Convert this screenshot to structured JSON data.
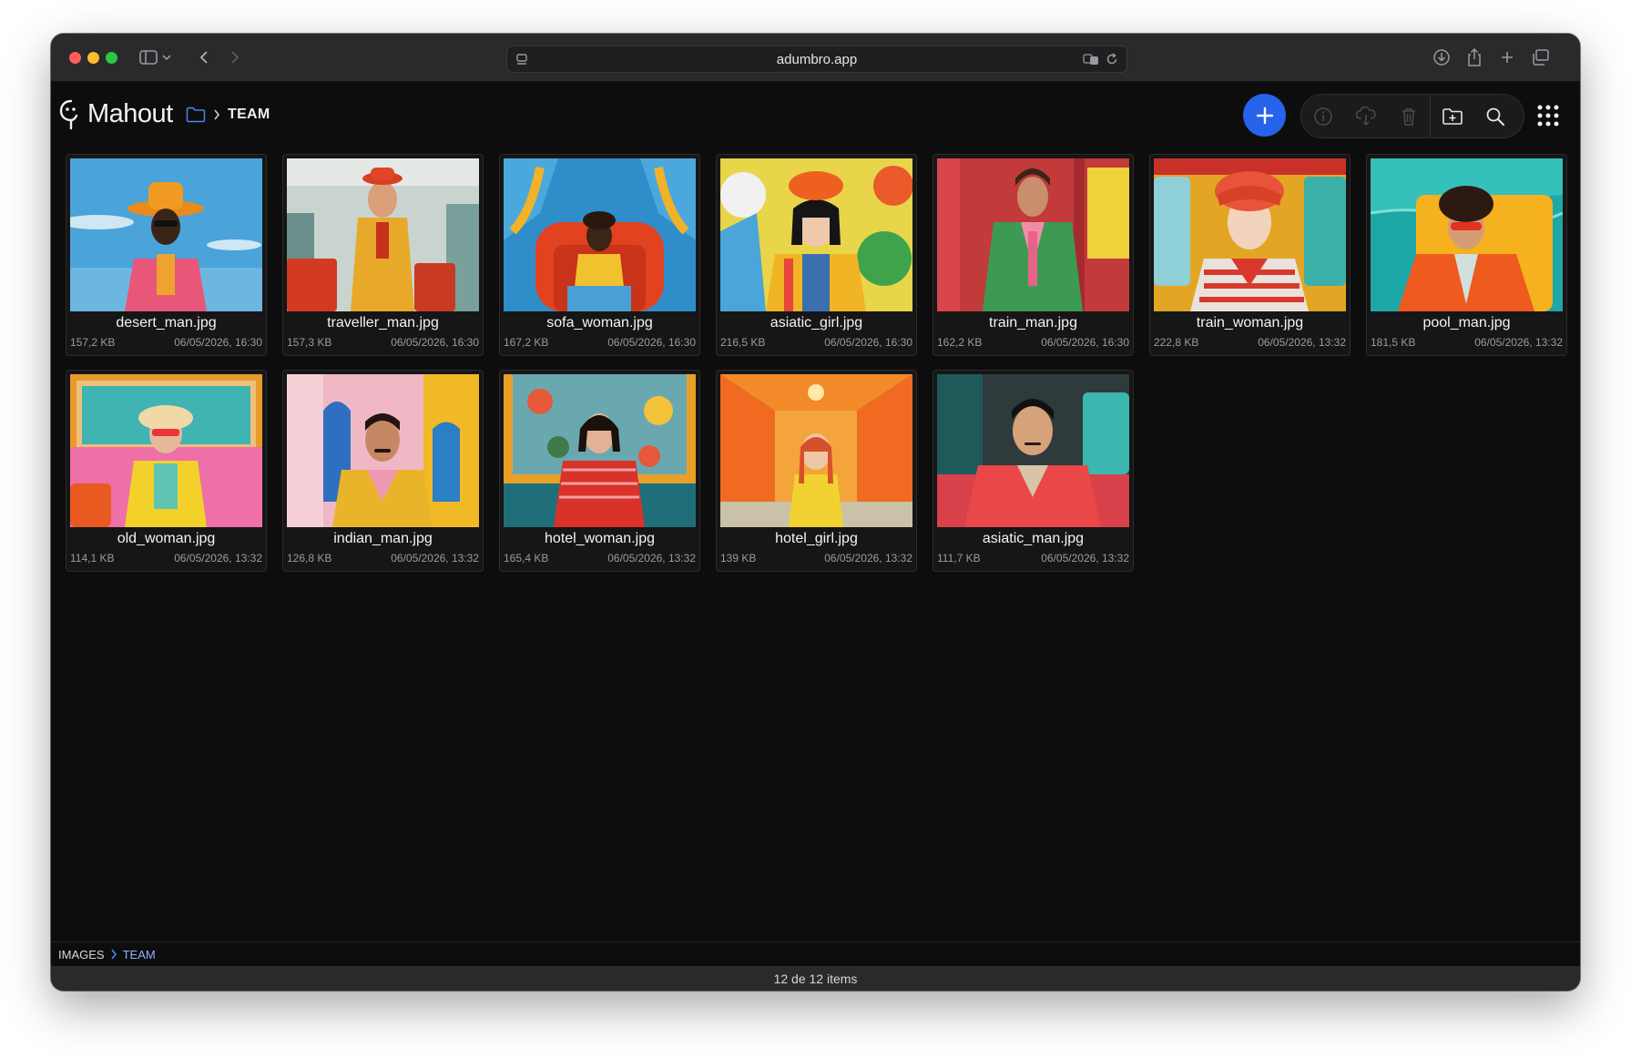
{
  "browser": {
    "url": "adumbro.app"
  },
  "app": {
    "logo_text": "Mahout",
    "breadcrumb_folder": "TEAM",
    "accent_color": "#2563eb"
  },
  "toolbar": {
    "add_icon": "plus-icon",
    "info_icon": "info-icon",
    "download_icon": "cloud-download-icon",
    "delete_icon": "trash-icon",
    "new_folder_icon": "folder-plus-icon",
    "search_icon": "search-icon",
    "apps_icon": "grid-menu-icon"
  },
  "files": [
    {
      "name": "desert_man.jpg",
      "size": "157,2 KB",
      "date": "06/05/2026, 16:30"
    },
    {
      "name": "traveller_man.jpg",
      "size": "157,3 KB",
      "date": "06/05/2026, 16:30"
    },
    {
      "name": "sofa_woman.jpg",
      "size": "167,2 KB",
      "date": "06/05/2026, 16:30"
    },
    {
      "name": "asiatic_girl.jpg",
      "size": "216,5 KB",
      "date": "06/05/2026, 16:30"
    },
    {
      "name": "train_man.jpg",
      "size": "162,2 KB",
      "date": "06/05/2026, 16:30"
    },
    {
      "name": "train_woman.jpg",
      "size": "222,8 KB",
      "date": "06/05/2026, 13:32"
    },
    {
      "name": "pool_man.jpg",
      "size": "181,5 KB",
      "date": "06/05/2026, 13:32"
    },
    {
      "name": "old_woman.jpg",
      "size": "114,1 KB",
      "date": "06/05/2026, 13:32"
    },
    {
      "name": "indian_man.jpg",
      "size": "126,8 KB",
      "date": "06/05/2026, 13:32"
    },
    {
      "name": "hotel_woman.jpg",
      "size": "165,4 KB",
      "date": "06/05/2026, 13:32"
    },
    {
      "name": "hotel_girl.jpg",
      "size": "139 KB",
      "date": "06/05/2026, 13:32"
    },
    {
      "name": "asiatic_man.jpg",
      "size": "111,7 KB",
      "date": "06/05/2026, 13:32"
    }
  ],
  "footer": {
    "path": [
      "IMAGES",
      "TEAM"
    ],
    "status": "12 de 12 items"
  }
}
